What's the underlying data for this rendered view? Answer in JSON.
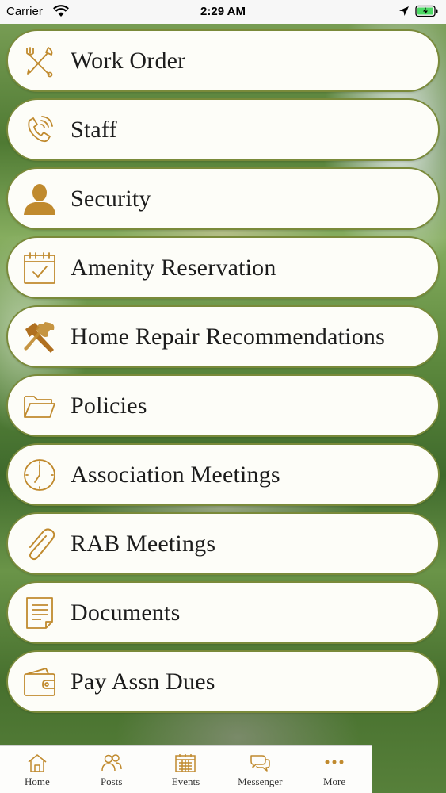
{
  "status_bar": {
    "carrier": "Carrier",
    "time": "2:29 AM"
  },
  "accent_color": "#c08a2e",
  "menu": {
    "items": [
      {
        "label": "Work Order",
        "icon": "tools-crossed-icon"
      },
      {
        "label": "Staff",
        "icon": "phone-icon"
      },
      {
        "label": "Security",
        "icon": "person-icon"
      },
      {
        "label": "Amenity Reservation",
        "icon": "calendar-check-icon"
      },
      {
        "label": "Home Repair Recommendations",
        "icon": "hammer-wrench-icon"
      },
      {
        "label": "Policies",
        "icon": "folder-icon"
      },
      {
        "label": "Association Meetings",
        "icon": "clock-icon"
      },
      {
        "label": "RAB Meetings",
        "icon": "paperclip-icon"
      },
      {
        "label": "Documents",
        "icon": "document-icon"
      },
      {
        "label": "Pay Assn Dues",
        "icon": "wallet-icon"
      }
    ]
  },
  "tab_bar": {
    "tabs": [
      {
        "label": "Home",
        "icon": "home-icon"
      },
      {
        "label": "Posts",
        "icon": "people-icon"
      },
      {
        "label": "Events",
        "icon": "calendar-icon"
      },
      {
        "label": "Messenger",
        "icon": "chat-icon"
      },
      {
        "label": "More",
        "icon": "more-dots-icon"
      }
    ]
  }
}
